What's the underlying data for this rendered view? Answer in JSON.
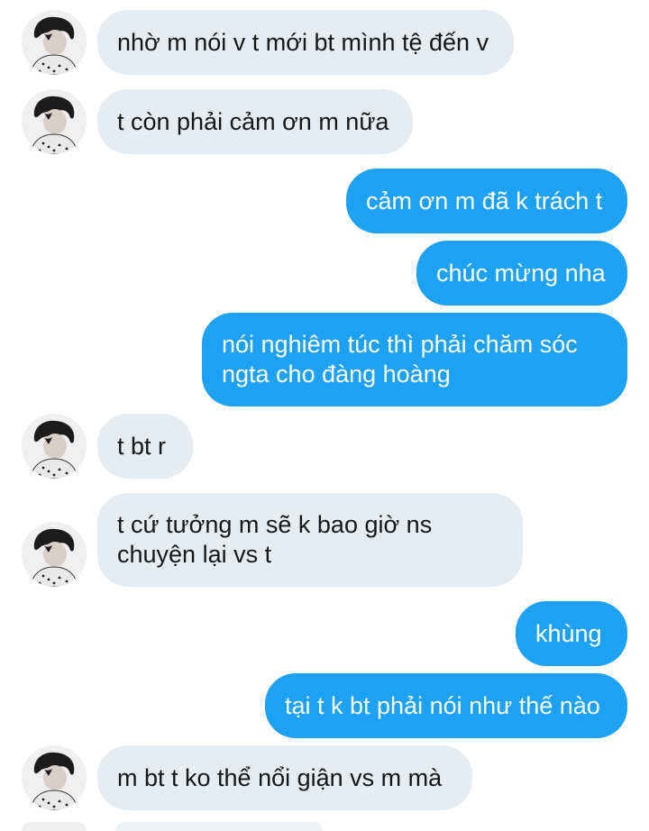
{
  "conversation": {
    "messages": [
      {
        "direction": "incoming",
        "has_avatar": true,
        "lines": [
          "nhờ m nói v t mới bt mình tệ đến v"
        ]
      },
      {
        "direction": "incoming",
        "has_avatar": true,
        "lines": [
          "t còn phải cảm ơn m nữa"
        ]
      },
      {
        "direction": "outgoing",
        "has_avatar": false,
        "lines": [
          "cảm ơn m đã k trách t"
        ]
      },
      {
        "direction": "outgoing",
        "has_avatar": false,
        "lines": [
          "chúc mừng nha"
        ]
      },
      {
        "direction": "outgoing",
        "has_avatar": false,
        "lines": [
          "nói nghiêm túc thì phải chăm sóc",
          "ngta cho đàng hoàng"
        ]
      },
      {
        "direction": "incoming",
        "has_avatar": true,
        "lines": [
          "t bt r"
        ]
      },
      {
        "direction": "incoming",
        "has_avatar": true,
        "lines": [
          "t cứ tưởng m sẽ k bao giờ ns",
          "chuyện lại vs t"
        ]
      },
      {
        "direction": "outgoing",
        "has_avatar": false,
        "lines": [
          "khùng"
        ]
      },
      {
        "direction": "outgoing",
        "has_avatar": false,
        "lines": [
          "tại t k bt phải nói như thế nào"
        ]
      },
      {
        "direction": "incoming",
        "has_avatar": true,
        "lines": [
          "m bt t ko thể nổi giận vs m mà"
        ]
      }
    ]
  },
  "colors": {
    "incoming_bubble": "#e6ecf0",
    "outgoing_bubble": "#1da1f2",
    "incoming_text": "#14171a",
    "outgoing_text": "#ffffff"
  },
  "icons": {
    "avatar": "profile-photo-avatar"
  }
}
